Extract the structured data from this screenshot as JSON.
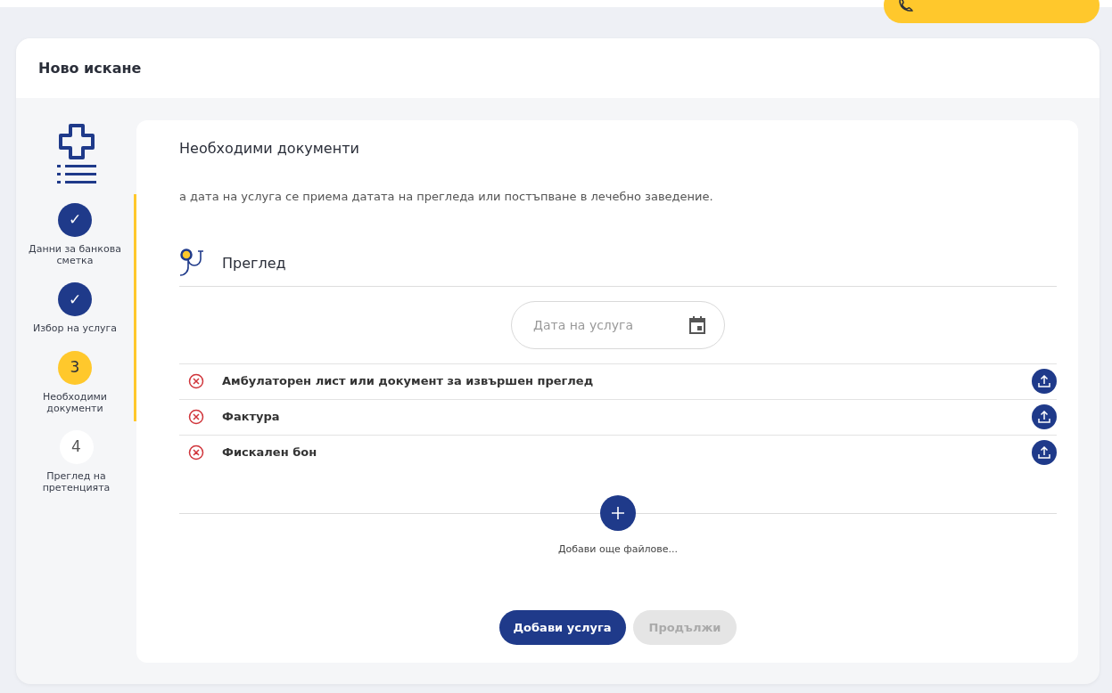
{
  "card": {
    "title": "Ново искане"
  },
  "steps": [
    {
      "marker": "✓",
      "label": "Данни за банкова сметка",
      "done": true,
      "selected": false
    },
    {
      "marker": "✓",
      "label": "Избор на услуга",
      "done": true,
      "selected": false
    },
    {
      "marker": "3",
      "label": "Необходими документи",
      "done": false,
      "selected": true
    },
    {
      "marker": "4",
      "label": "Преглед на претенцията",
      "done": false,
      "selected": false
    }
  ],
  "section": {
    "title": "Необходими документи",
    "note": "а дата на услуга се приема датата на прегледа или постъпване в лечебно заведение."
  },
  "service": {
    "name": "Преглед",
    "date_field": {
      "placeholder": "Дата на услуга"
    }
  },
  "documents": [
    {
      "name": "Амбулаторен лист или документ за извършен преглед",
      "uploaded": false
    },
    {
      "name": "Фактура",
      "uploaded": false
    },
    {
      "name": "Фискален бон",
      "uploaded": false
    }
  ],
  "add_files": {
    "label": "Добави още файлове..."
  },
  "buttons": [
    {
      "label": "Добави услуга",
      "disabled": false
    },
    {
      "label": "Продължи",
      "disabled": true
    }
  ]
}
